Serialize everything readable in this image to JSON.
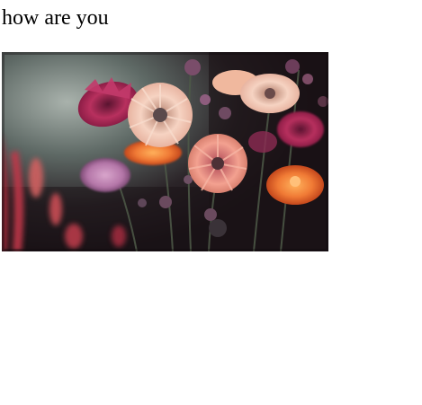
{
  "page": {
    "heading": "how are you"
  },
  "image": {
    "subject": "flower-bouquet-photo",
    "colors": {
      "background_dark": "#1c1418",
      "background_mist": "#9aa39e",
      "pink_bloom": "#e99a8e",
      "peach_bloom": "#f3c8b4",
      "magenta_bloom": "#b5275a",
      "orange_bloom": "#f07a35",
      "lilac_bloom": "#b476a8",
      "stem_green": "#4e5a48"
    }
  }
}
